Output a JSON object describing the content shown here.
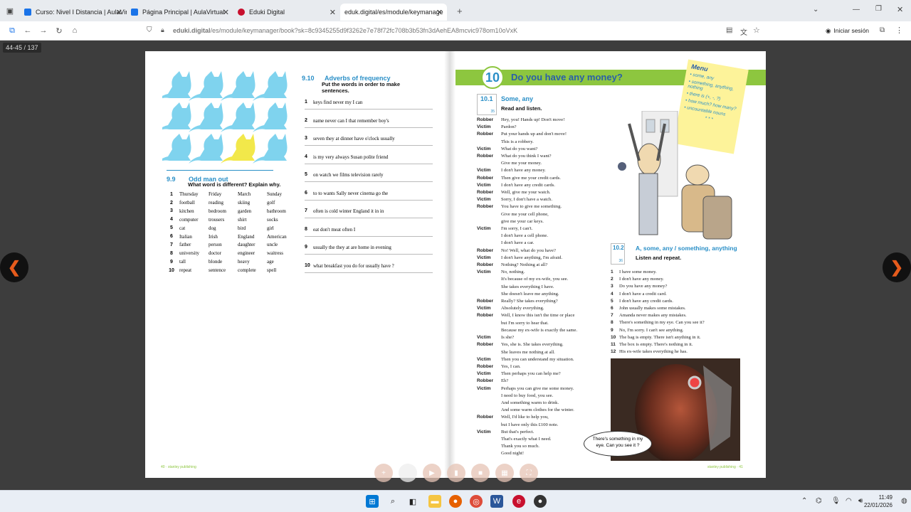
{
  "tabs": [
    {
      "label": "Curso: Nivel I Distancia | AulaVir",
      "color": "#1a73e8"
    },
    {
      "label": "Página Principal | AulaVirtual",
      "color": "#1a73e8"
    },
    {
      "label": "Eduki Digital",
      "color": "#c8102e"
    },
    {
      "label": "eduk.digital/es/module/keymanage",
      "color": "#888888",
      "active": true
    }
  ],
  "address": {
    "domain": "eduki.digital",
    "path": "/es/module/keymanager/book?sk=8c9345255d9f3262e7e78f72fc708b3b53fn3dAehEA8mcvic978om10oVxK",
    "signin": "Iniciar sesión"
  },
  "viewer": {
    "page_counter": "44-45 / 137"
  },
  "left_page": {
    "adverbs": {
      "num": "9.10",
      "title": "Adverbs of frequency",
      "instruction": "Put the words in order to make sentences.",
      "items": [
        {
          "n": "1",
          "t": "keys find never my I can"
        },
        {
          "n": "2",
          "t": "name never can I that remember boy's"
        },
        {
          "n": "3",
          "t": "seven they at dinner have o'clock usually"
        },
        {
          "n": "4",
          "t": "is my very always Susan polite friend"
        },
        {
          "n": "5",
          "t": "on watch we films television rarely"
        },
        {
          "n": "6",
          "t": "to to wants Sally never cinema go the"
        },
        {
          "n": "7",
          "t": "often is cold winter England it in in"
        },
        {
          "n": "8",
          "t": "eat don't meat often I"
        },
        {
          "n": "9",
          "t": "usually the they at are home in evening"
        },
        {
          "n": "10",
          "t": "what breakfast you do for usually have ?"
        }
      ]
    },
    "odd": {
      "num": "9.9",
      "title": "Odd man out",
      "instruction": "What word is different? Explain why.",
      "rows": [
        [
          "1",
          "Thursday",
          "Friday",
          "March",
          "Sunday"
        ],
        [
          "2",
          "football",
          "reading",
          "skiing",
          "golf"
        ],
        [
          "3",
          "kitchen",
          "bedroom",
          "garden",
          "bathroom"
        ],
        [
          "4",
          "computer",
          "trousers",
          "shirt",
          "socks"
        ],
        [
          "5",
          "cat",
          "dog",
          "bird",
          "girl"
        ],
        [
          "6",
          "Italian",
          "Irish",
          "England",
          "American"
        ],
        [
          "7",
          "father",
          "person",
          "daughter",
          "uncle"
        ],
        [
          "8",
          "university",
          "doctor",
          "engineer",
          "waitress"
        ],
        [
          "9",
          "tall",
          "blonde",
          "heavy",
          "age"
        ],
        [
          "10",
          "repeat",
          "sentence",
          "complete",
          "spell"
        ]
      ]
    },
    "footer": "40 · stanley publishing"
  },
  "right_page": {
    "unit_num": "10",
    "unit_title": "Do you have any money?",
    "menu": {
      "title": "Menu",
      "items": [
        "• some, any",
        "• something, anything, nothing",
        "• there is (+, -, ?)",
        "• how much? how many?",
        "• uncountable nouns"
      ],
      "stars": "* * *"
    },
    "s1": {
      "num": "10.1",
      "title": "Some, any",
      "instruction": "Read and listen.",
      "track": "35"
    },
    "dialogue": [
      {
        "sp": "Robber",
        "t": "Hey, you! Hands up! Don't move!"
      },
      {
        "sp": "Victim",
        "t": "Pardon?"
      },
      {
        "sp": "Robber",
        "t": "Put your hands up and don't move!"
      },
      {
        "sp": "",
        "t": "This is a robbery."
      },
      {
        "sp": "Victim",
        "t": "What do you want?"
      },
      {
        "sp": "Robber",
        "t": "What do you think I want?"
      },
      {
        "sp": "",
        "t": "Give me your money."
      },
      {
        "sp": "Victim",
        "t": "I don't have any money."
      },
      {
        "sp": "Robber",
        "t": "Then give me your credit cards."
      },
      {
        "sp": "Victim",
        "t": "I don't have any credit cards."
      },
      {
        "sp": "Robber",
        "t": "Well, give me your watch."
      },
      {
        "sp": "Victim",
        "t": "Sorry, I don't have a watch."
      },
      {
        "sp": "Robber",
        "t": "You have to give me something."
      },
      {
        "sp": "",
        "t": "Give me your cell phone,"
      },
      {
        "sp": "",
        "t": "give me your car keys."
      },
      {
        "sp": "Victim",
        "t": "I'm sorry, I can't."
      },
      {
        "sp": "",
        "t": "I don't have a cell phone."
      },
      {
        "sp": "",
        "t": "I don't have a car."
      },
      {
        "sp": "Robber",
        "t": "No! Well, what do you have?"
      },
      {
        "sp": "Victim",
        "t": "I don't have anything, I'm afraid."
      },
      {
        "sp": "Robber",
        "t": "Nothing? Nothing at all?"
      },
      {
        "sp": "Victim",
        "t": "No, nothing."
      },
      {
        "sp": "",
        "t": "It's because of my ex-wife, you see."
      },
      {
        "sp": "",
        "t": "She takes everything I have."
      },
      {
        "sp": "",
        "t": "She doesn't leave me anything."
      },
      {
        "sp": "Robber",
        "t": "Really? She takes everything?"
      },
      {
        "sp": "Victim",
        "t": "Absolutely everything."
      },
      {
        "sp": "Robber",
        "t": "Well, I know this isn't the time or place"
      },
      {
        "sp": "",
        "t": "but I'm sorry to hear that."
      },
      {
        "sp": "",
        "t": "Because my ex-wife is exactly the same."
      },
      {
        "sp": "Victim",
        "t": "Is she?"
      },
      {
        "sp": "Robber",
        "t": "Yes, she is. She takes everything."
      },
      {
        "sp": "",
        "t": "She leaves me nothing at all."
      },
      {
        "sp": "Victim",
        "t": "Then you can understand my situation."
      },
      {
        "sp": "Robber",
        "t": "Yes, I can."
      },
      {
        "sp": "Victim",
        "t": "Then perhaps you can help me?"
      },
      {
        "sp": "Robber",
        "t": "Eh?"
      },
      {
        "sp": "Victim",
        "t": "Perhaps you can give me some money."
      },
      {
        "sp": "",
        "t": "I need to buy food, you see."
      },
      {
        "sp": "",
        "t": "And something warm to drink."
      },
      {
        "sp": "",
        "t": "And some warm clothes for the winter."
      },
      {
        "sp": "Robber",
        "t": "Well, I'd like to help you,"
      },
      {
        "sp": "",
        "t": "but I have only this £100 note."
      },
      {
        "sp": "Victim",
        "t": "But that's perfect."
      },
      {
        "sp": "",
        "t": "That's exactly what I need."
      },
      {
        "sp": "",
        "t": "Thank you so much."
      },
      {
        "sp": "",
        "t": "Good night!"
      }
    ],
    "s2": {
      "num": "10.2",
      "title": "A, some, any / something, anything",
      "instruction": "Listen and repeat.",
      "track": "36"
    },
    "repeat": [
      {
        "n": "1",
        "t": "I have some money."
      },
      {
        "n": "2",
        "t": "I don't have any money."
      },
      {
        "n": "3",
        "t": "Do you have any money?"
      },
      {
        "n": "4",
        "t": "I don't have a credit card."
      },
      {
        "n": "5",
        "t": "I don't have any credit cards."
      },
      {
        "n": "6",
        "t": "John usually makes some mistakes."
      },
      {
        "n": "7",
        "t": "Amanda never makes any mistakes."
      },
      {
        "n": "8",
        "t": "There's something in my eye. Can you see it?"
      },
      {
        "n": "9",
        "t": "No, I'm sorry. I can't see anything."
      },
      {
        "n": "10",
        "t": "The bag is empty. There isn't anything in it."
      },
      {
        "n": "11",
        "t": "The box is empty. There's nothing in it."
      },
      {
        "n": "12",
        "t": "His ex-wife takes everything he has."
      }
    ],
    "bubble": "There's something in my eye. Can you see it ?",
    "footer": "stanley publishing · 41"
  },
  "taskbar": {
    "time": "11:49",
    "date": "22/01/2026"
  },
  "colors": {
    "accent_green": "#8dc63f",
    "accent_blue": "#2a8fc7",
    "nav_arrow": "#e65b1c"
  }
}
